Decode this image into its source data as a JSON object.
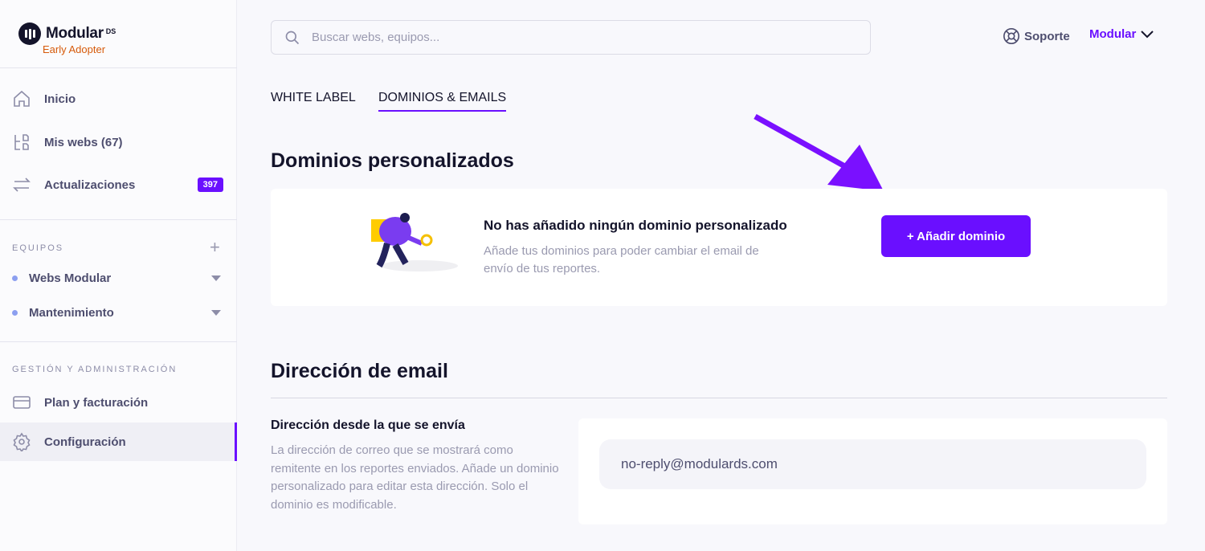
{
  "brand": {
    "name": "Modular",
    "suffix": "DS",
    "tagline": "Early Adopter"
  },
  "sidebar": {
    "nav": [
      {
        "label": "Inicio",
        "icon": "home-icon"
      },
      {
        "label": "Mis webs (67)",
        "icon": "sites-icon"
      },
      {
        "label": "Actualizaciones",
        "icon": "arrows-icon",
        "badge": "397"
      }
    ],
    "teams_heading": "EQUIPOS",
    "teams": [
      {
        "label": "Webs Modular"
      },
      {
        "label": "Mantenimiento"
      }
    ],
    "admin_heading": "GESTIÓN Y ADMINISTRACIÓN",
    "admin": [
      {
        "label": "Plan y facturación",
        "icon": "credit-card-icon"
      },
      {
        "label": "Configuración",
        "icon": "gear-icon",
        "active": true
      }
    ]
  },
  "header": {
    "search_placeholder": "Buscar webs, equipos...",
    "support": "Soporte",
    "account": "Modular"
  },
  "tabs": [
    {
      "label": "WHITE LABEL"
    },
    {
      "label": "DOMINIOS & EMAILS",
      "active": true
    }
  ],
  "domains": {
    "title": "Dominios personalizados",
    "empty_title": "No has añadido ningún dominio personalizado",
    "empty_desc": "Añade tus dominios para poder cambiar el email de envío de tus reportes.",
    "add_button": "+ Añadir dominio"
  },
  "email": {
    "title": "Dirección de email",
    "label": "Dirección desde la que se envía",
    "help": "La dirección de correo que se mostrará como remitente en los reportes enviados. Añade un dominio personalizado para editar esta dirección. Solo el dominio es modificable.",
    "value": "no-reply@modulards.com"
  },
  "colors": {
    "accent": "#6a0fff",
    "brand_orange": "#d65a0a"
  }
}
